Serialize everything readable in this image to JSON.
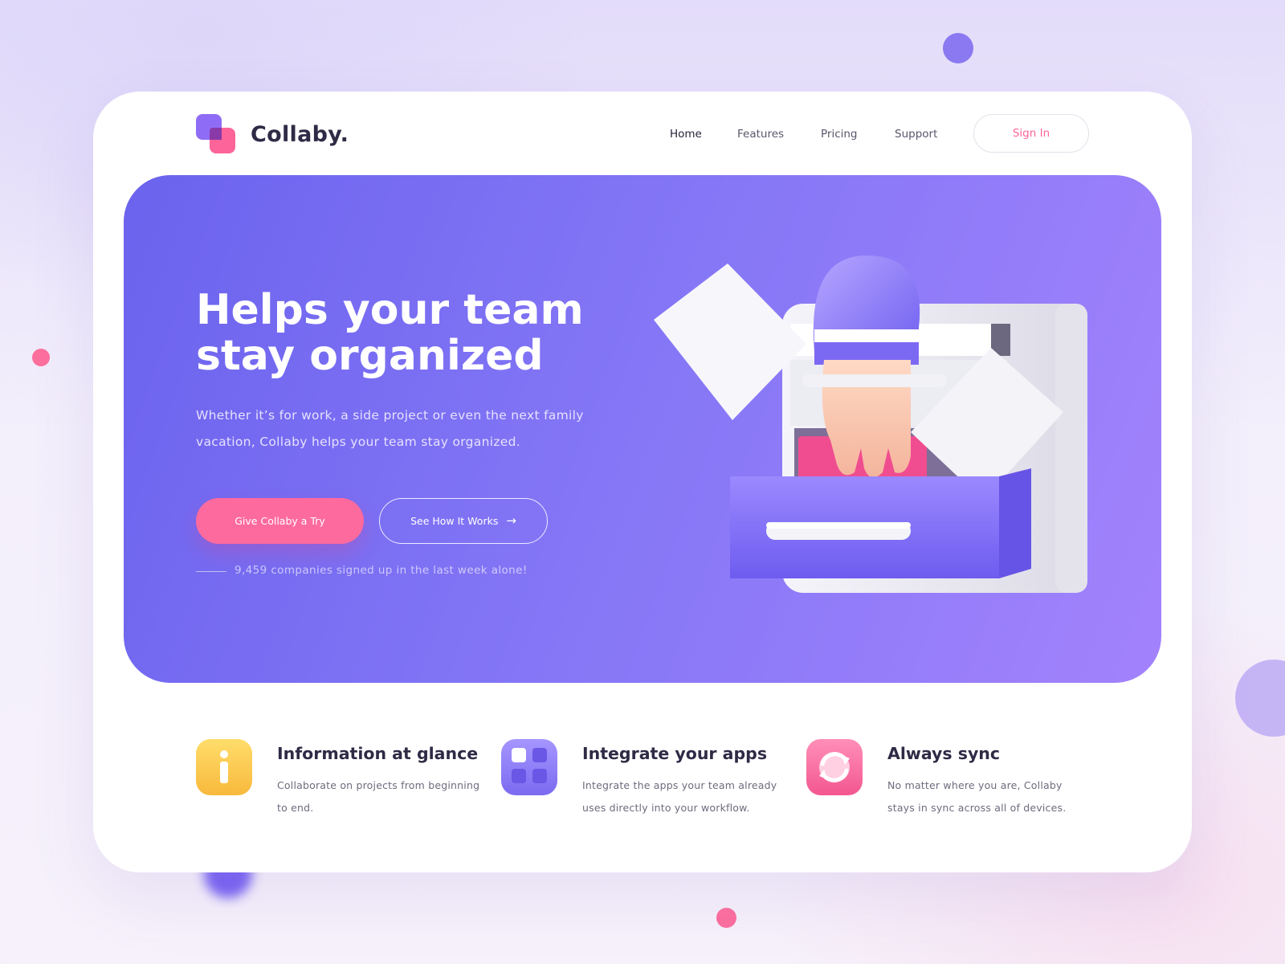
{
  "brand": {
    "name": "Collaby."
  },
  "nav": {
    "items": [
      {
        "label": "Home",
        "active": true
      },
      {
        "label": "Features",
        "active": false
      },
      {
        "label": "Pricing",
        "active": false
      },
      {
        "label": "Support",
        "active": false
      }
    ],
    "signin_label": "Sign In"
  },
  "hero": {
    "title_line1": "Helps your team",
    "title_line2": "stay organized",
    "subtitle": "Whether it’s for work, a side project or even the next family vacation, Collaby helps your team stay organized.",
    "primary_cta": "Give Collaby a Try",
    "secondary_cta": "See How It Works",
    "signup_note": "9,459 companies signed up in the last week alone!",
    "illustration": "3d-hand-drawer-icon"
  },
  "features": [
    {
      "icon": "info-icon",
      "title": "Information at glance",
      "desc": "Collaborate on projects from beginning to end.",
      "color": "#fdc651"
    },
    {
      "icon": "apps-grid-icon",
      "title": "Integrate your apps",
      "desc": "Integrate the apps your team already uses directly into your workflow.",
      "color": "#8f79f5"
    },
    {
      "icon": "sync-icon",
      "title": "Always sync",
      "desc": "No matter where you are, Collaby stays in sync across all of devices.",
      "color": "#fd6a9e"
    }
  ],
  "colors": {
    "accent_pink": "#fd6a9e",
    "accent_purple": "#7b6cf2",
    "hero_gradient_start": "#6b63ee",
    "hero_gradient_end": "#a382fc",
    "text_dark": "#2f2a45"
  }
}
